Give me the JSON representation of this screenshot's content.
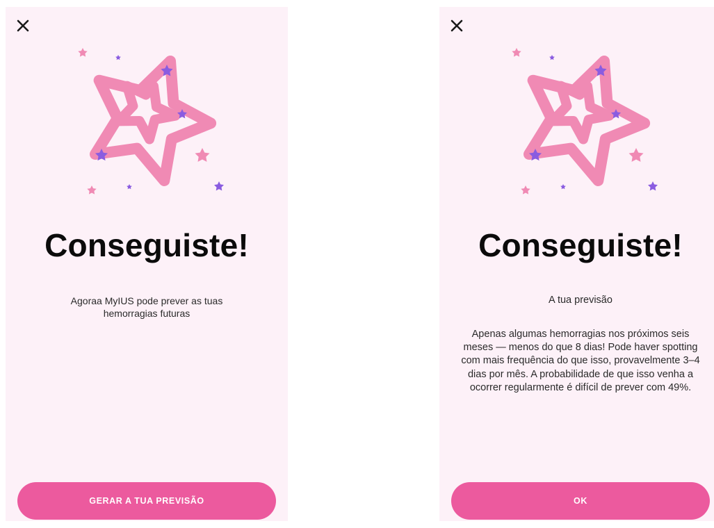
{
  "screens": {
    "left": {
      "close_icon": "close-icon",
      "title": "Conseguiste!",
      "description": "Agoraa MyIUS pode prever as tuas hemorragias futuras",
      "button_label": "GERAR A TUA PREVISÃO"
    },
    "right": {
      "close_icon": "close-icon",
      "title": "Conseguiste!",
      "subtitle": "A tua previsão",
      "description": "Apenas algumas hemorragias nos próximos seis meses — menos do que 8 dias! Pode haver spotting com mais frequência do que isso, provavelmente 3–4 dias por mês. A probabilidade de que isso venha a ocorrer regularmente é difícil de prever com 49%.",
      "button_label": "OK"
    }
  },
  "colors": {
    "background": "#fdf1f8",
    "accent": "#ec5a9e",
    "star_pink": "#f08ab4",
    "star_purple": "#8a5ce0"
  }
}
